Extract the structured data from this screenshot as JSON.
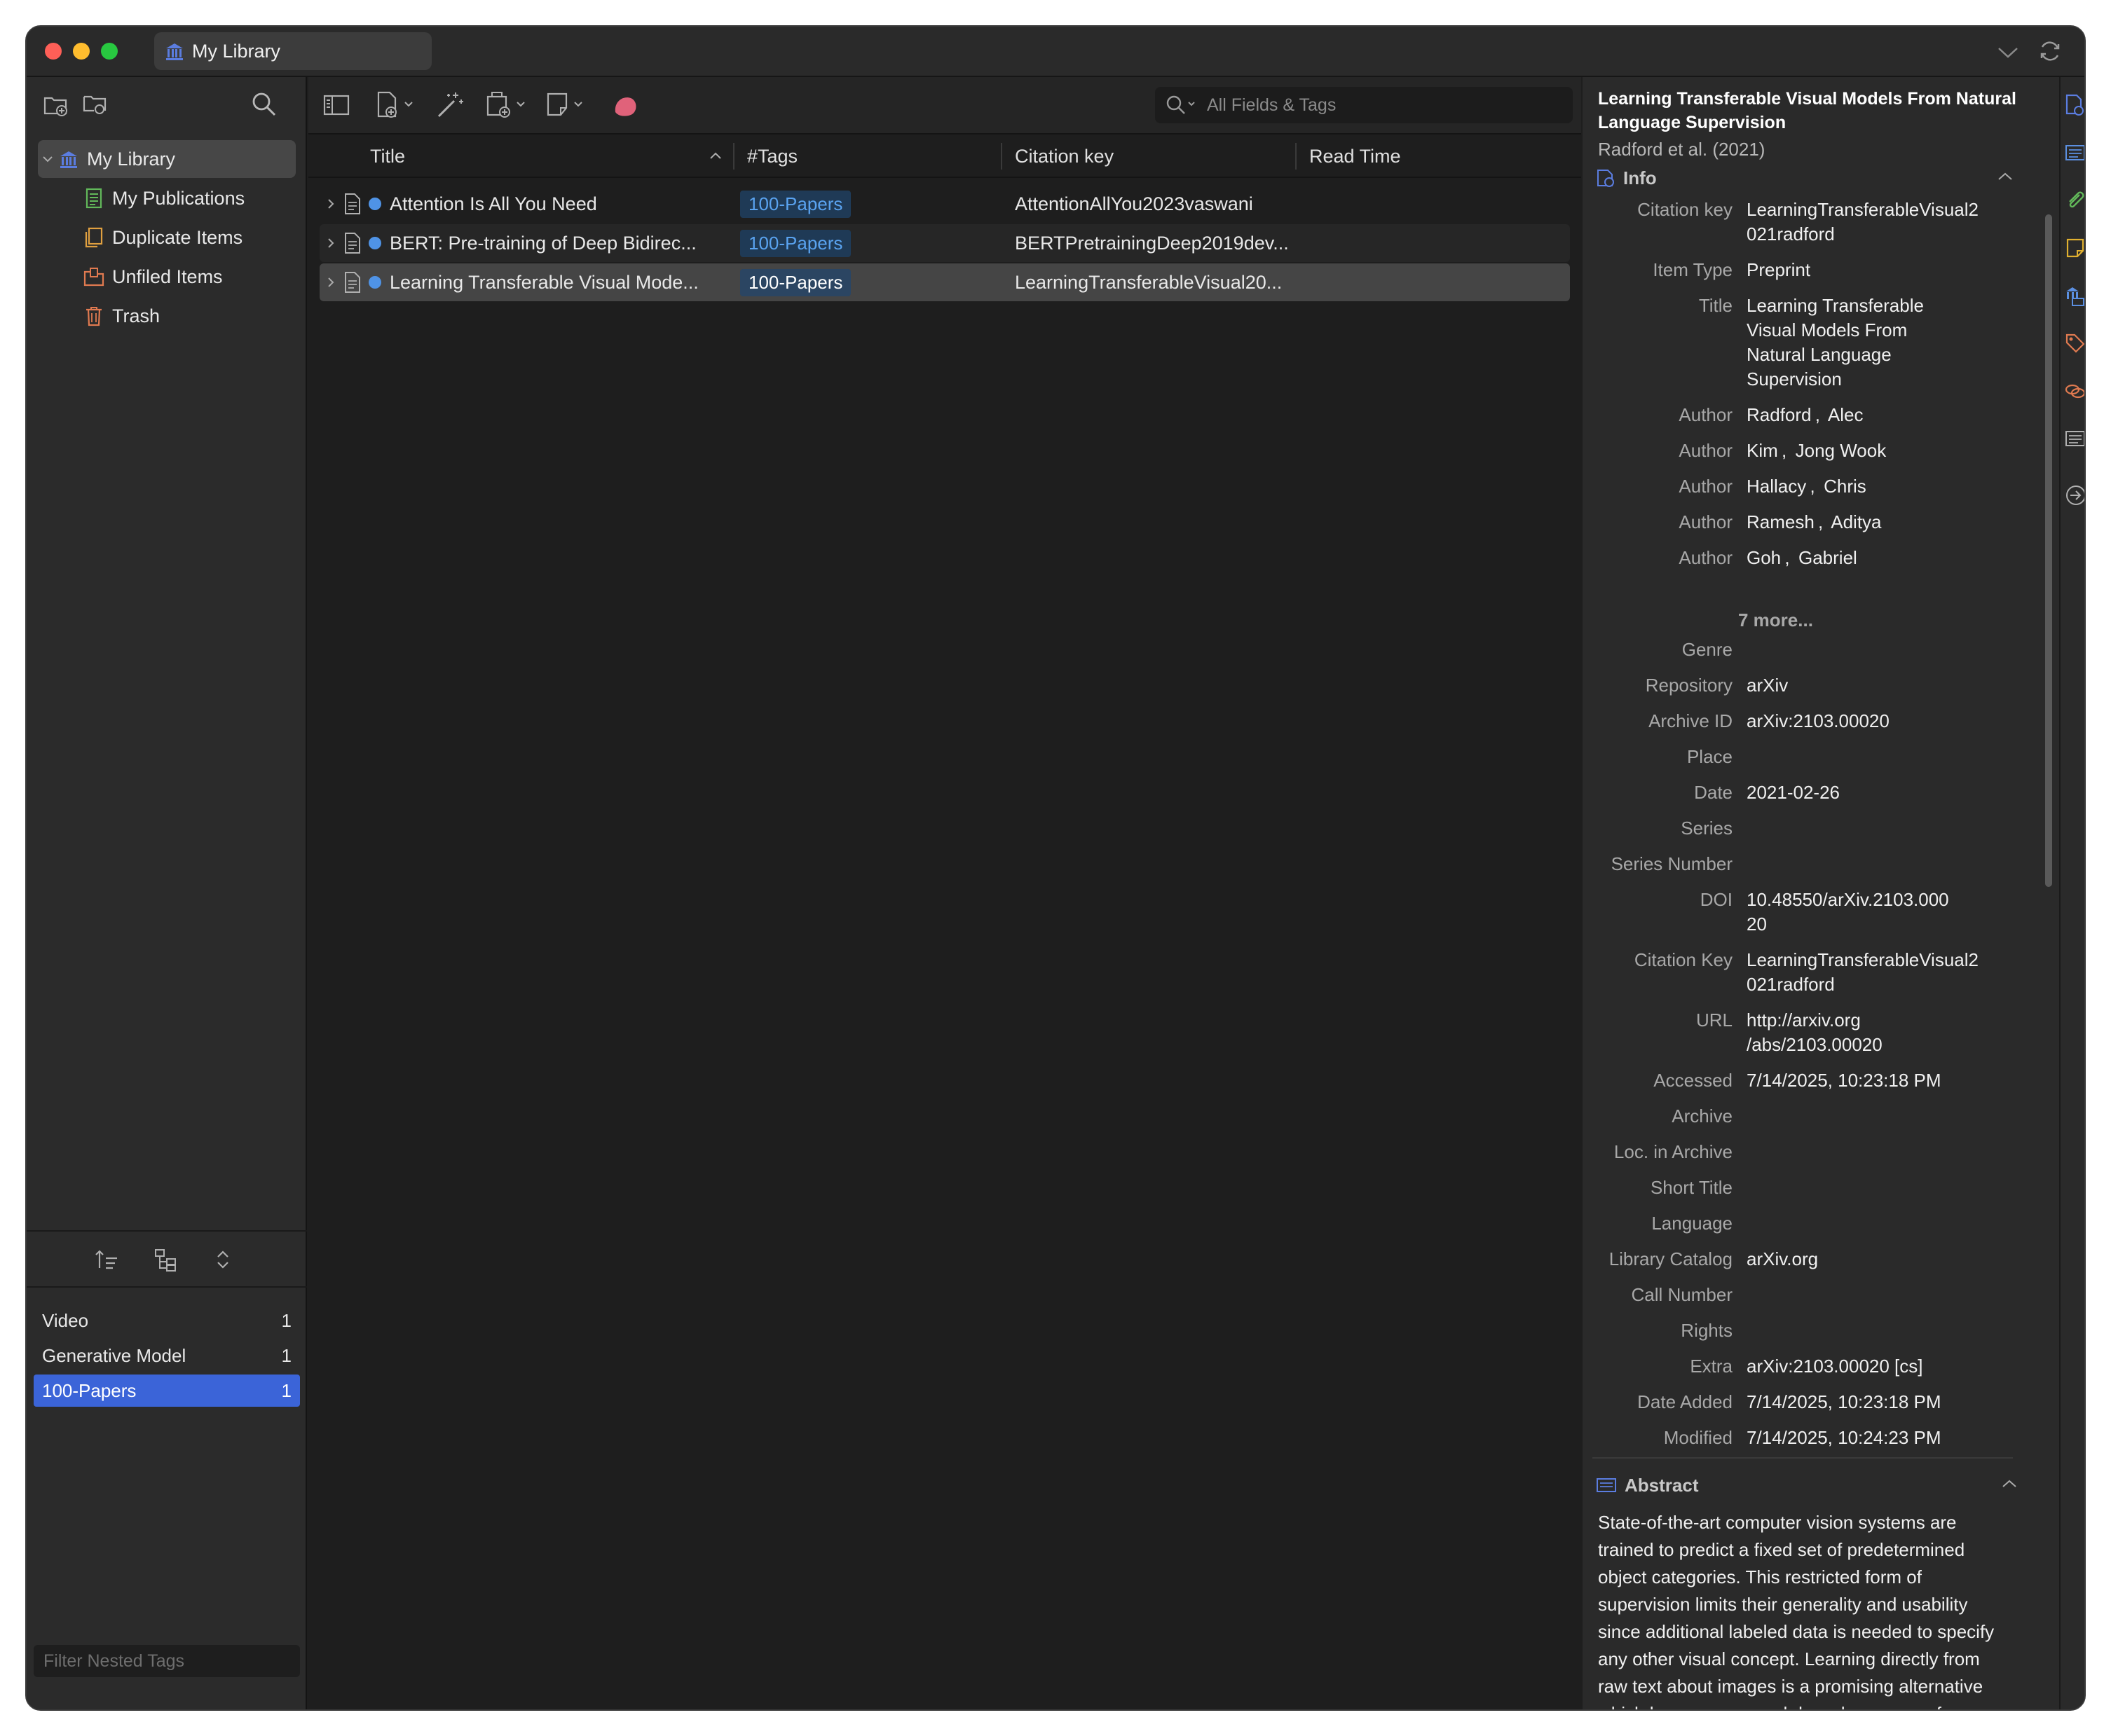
{
  "window": {
    "tab_title": "My Library"
  },
  "collections": {
    "root": "My Library",
    "items": [
      {
        "label": "My Publications"
      },
      {
        "label": "Duplicate Items"
      },
      {
        "label": "Unfiled Items"
      },
      {
        "label": "Trash"
      }
    ]
  },
  "tags": {
    "items": [
      {
        "label": "Video",
        "count": "1"
      },
      {
        "label": "Generative Model",
        "count": "1"
      },
      {
        "label": "100-Papers",
        "count": "1"
      }
    ],
    "filter_placeholder": "Filter Nested Tags"
  },
  "search": {
    "placeholder": "All Fields & Tags"
  },
  "columns": {
    "title": "Title",
    "tags": "#Tags",
    "citation_key": "Citation key",
    "read_time": "Read Time"
  },
  "items": [
    {
      "title": "Attention Is All You Need",
      "tag": "100-Papers",
      "citation_key": "AttentionAllYou2023vaswani"
    },
    {
      "title": "BERT: Pre-training of Deep Bidirec...",
      "tag": "100-Papers",
      "citation_key": "BERTPretrainingDeep2019dev..."
    },
    {
      "title": "Learning Transferable Visual Mode...",
      "tag": "100-Papers",
      "citation_key": "LearningTransferableVisual20..."
    }
  ],
  "detail": {
    "title": "Learning Transferable Visual Models From Natural Language Supervision",
    "subtitle": "Radford et al. (2021)",
    "info_header": "Info",
    "fields": [
      {
        "label": "Citation key",
        "value": "LearningTransferableVisual2\n021radford"
      },
      {
        "label": "Item Type",
        "value": "Preprint"
      },
      {
        "label": "Title",
        "value": "Learning Transferable\nVisual Models From\nNatural Language\nSupervision"
      },
      {
        "label": "Author",
        "value": "Radford ,  Alec"
      },
      {
        "label": "Author",
        "value": "Kim ,  Jong Wook"
      },
      {
        "label": "Author",
        "value": "Hallacy ,  Chris"
      },
      {
        "label": "Author",
        "value": "Ramesh ,  Aditya"
      },
      {
        "label": "Author",
        "value": "Goh ,  Gabriel"
      }
    ],
    "more_authors": "7 more...",
    "fields2": [
      {
        "label": "Genre",
        "value": ""
      },
      {
        "label": "Repository",
        "value": "arXiv"
      },
      {
        "label": "Archive ID",
        "value": "arXiv:2103.00020"
      },
      {
        "label": "Place",
        "value": ""
      },
      {
        "label": "Date",
        "value": "2021-02-26"
      },
      {
        "label": "Series",
        "value": ""
      },
      {
        "label": "Series Number",
        "value": ""
      },
      {
        "label": "DOI",
        "value": "10.48550/arXiv.2103.000\n20"
      },
      {
        "label": "Citation Key",
        "value": "LearningTransferableVisual2\n021radford"
      },
      {
        "label": "URL",
        "value": "http://arxiv.org\n/abs/2103.00020"
      },
      {
        "label": "Accessed",
        "value": "7/14/2025, 10:23:18 PM"
      },
      {
        "label": "Archive",
        "value": ""
      },
      {
        "label": "Loc. in Archive",
        "value": ""
      },
      {
        "label": "Short Title",
        "value": ""
      },
      {
        "label": "Language",
        "value": ""
      },
      {
        "label": "Library Catalog",
        "value": "arXiv.org"
      },
      {
        "label": "Call Number",
        "value": ""
      },
      {
        "label": "Rights",
        "value": ""
      },
      {
        "label": "Extra",
        "value": "arXiv:2103.00020 [cs]"
      },
      {
        "label": "Date Added",
        "value": "7/14/2025, 10:23:18 PM"
      },
      {
        "label": "Modified",
        "value": "7/14/2025, 10:24:23 PM"
      }
    ],
    "abstract_header": "Abstract",
    "abstract": "State-of-the-art computer vision systems are trained to predict a fixed set of predetermined object categories. This restricted form of supervision limits their generality and usability since additional labeled data is needed to specify any other visual concept. Learning directly from raw text about images is a promising alternative which leverages a much broader source of"
  },
  "colors": {
    "accent": "#3b64d8",
    "tag_chip_text": "#5aa3f0",
    "dot": "#4f93e6",
    "close": "#fe5f57",
    "minimize": "#febc2e",
    "zoom": "#28c840"
  }
}
